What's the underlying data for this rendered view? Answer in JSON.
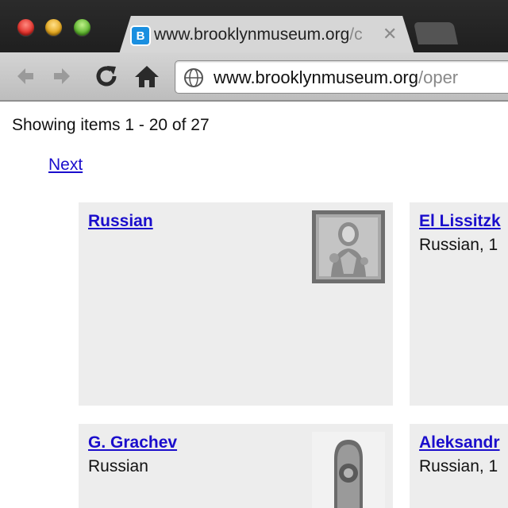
{
  "browser": {
    "tab": {
      "favicon_letter": "B",
      "title_main": "www.brooklynmuseum.org",
      "title_faded": "/c",
      "close_glyph": "✕"
    },
    "nav": {
      "back_icon": "back-arrow-icon",
      "forward_icon": "forward-arrow-icon",
      "reload_icon": "reload-icon",
      "home_icon": "home-icon"
    },
    "address": {
      "host": "www.brooklynmuseum.org",
      "path": "/oper"
    }
  },
  "page": {
    "showing_text": "Showing items 1 - 20 of 27",
    "next_label": "Next"
  },
  "cards": [
    {
      "name": "Russian",
      "subtitle": "",
      "thumb": "icon-painting"
    },
    {
      "name": "El Lissitzk",
      "subtitle": "Russian, 1",
      "thumb": ""
    },
    {
      "name": "G. Grachev",
      "subtitle": "Russian",
      "thumb": "sculpture-photo"
    },
    {
      "name": "Aleksandr",
      "subtitle": "Russian, 1",
      "thumb": ""
    }
  ],
  "colors": {
    "link": "#1a0dcc",
    "card_bg": "#ededed",
    "chrome_dark": "#222222",
    "toolbar": "#c8c8c8"
  }
}
